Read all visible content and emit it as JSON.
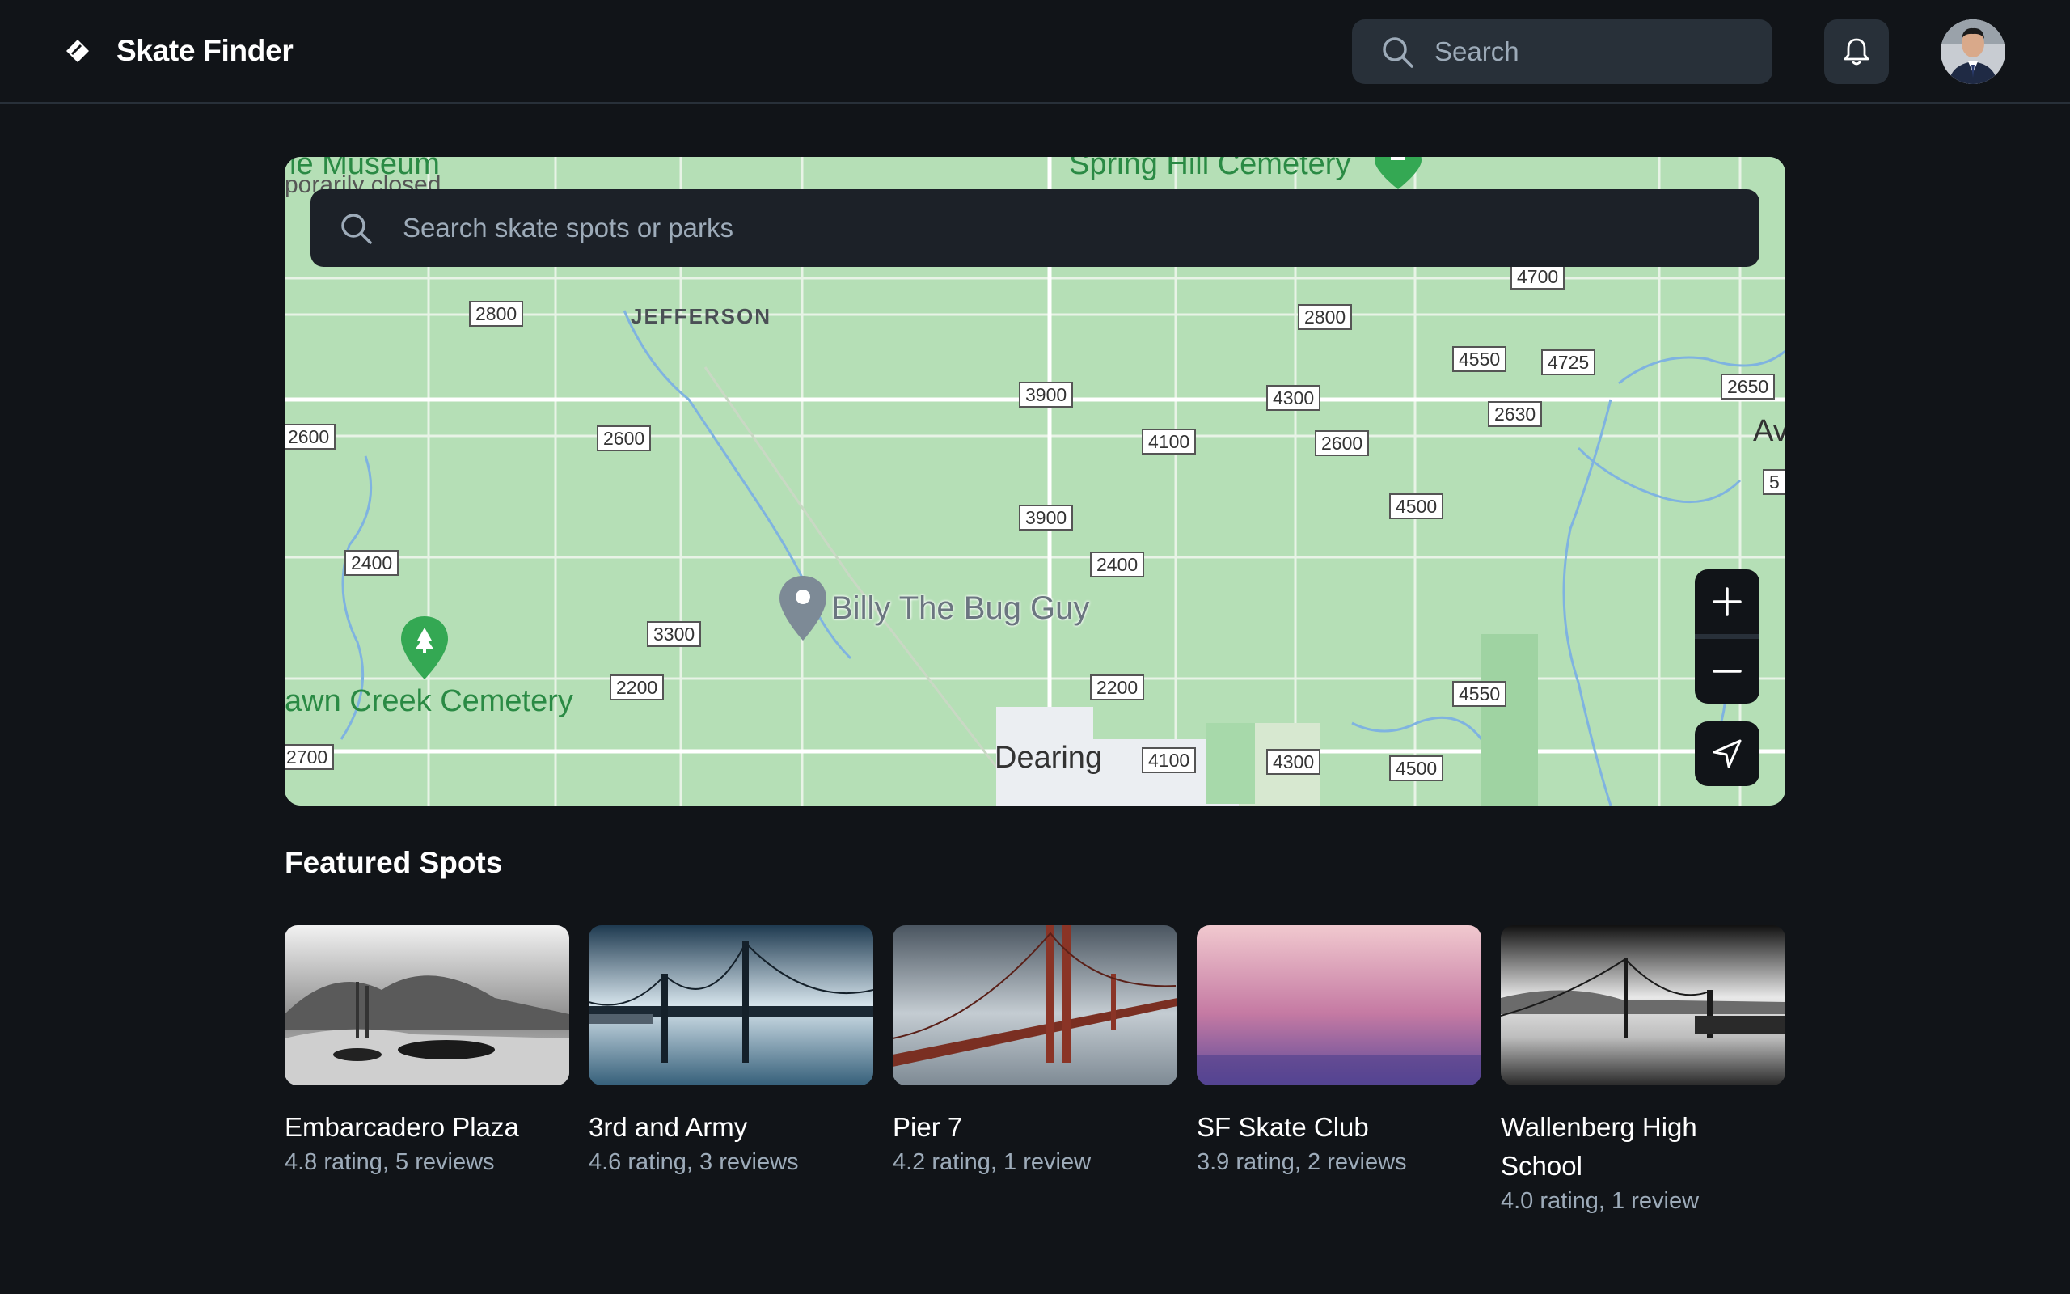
{
  "header": {
    "title": "Skate Finder",
    "search_placeholder": "Search"
  },
  "map": {
    "search_placeholder": "Search skate spots or parks",
    "pin_label": "Billy The Bug Guy",
    "place_labels": {
      "jefferson": "JEFFERSON",
      "dearing": "Dearing",
      "cemetery_left": "awn Creek Cemetery",
      "cemetery_top": "Spring Hill Cemetery",
      "museum": "le Museum",
      "museum_sub": "porarily closed",
      "edge_av": "Av"
    },
    "road_numbers": [
      "2800",
      "2800",
      "4700",
      "4550",
      "4725",
      "2650",
      "2630",
      "3900",
      "4300",
      "4100",
      "2600",
      "2600",
      "2600",
      "4500",
      "3900",
      "2400",
      "2400",
      "3300",
      "2200",
      "2200",
      "4550",
      "4100",
      "4300",
      "4500",
      "2700",
      "5"
    ]
  },
  "featured": {
    "title": "Featured Spots",
    "spots": [
      {
        "name": "Embarcadero Plaza",
        "meta": "4.8 rating, 5 reviews"
      },
      {
        "name": "3rd and Army",
        "meta": "4.6 rating, 3 reviews"
      },
      {
        "name": "Pier 7",
        "meta": "4.2 rating, 1 review"
      },
      {
        "name": "SF Skate Club",
        "meta": "3.9 rating, 2 reviews"
      },
      {
        "name": "Wallenberg High School",
        "meta": "4.0 rating, 1 review"
      }
    ]
  },
  "icons": {
    "brand": "diamond-logo-icon",
    "search": "search-icon",
    "notifications": "bell-icon",
    "zoom_in": "plus-icon",
    "zoom_out": "minus-icon",
    "locate": "navigation-arrow-icon"
  }
}
